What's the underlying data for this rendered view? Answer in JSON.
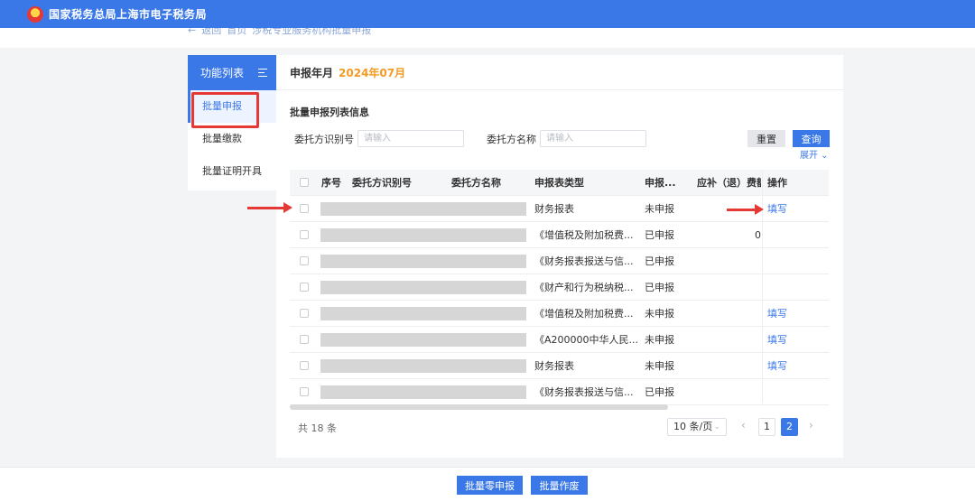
{
  "header": {
    "title": "国家税务总局上海市电子税务局"
  },
  "breadcrumb": {
    "back": "返回",
    "home": "首页",
    "current": "涉税专业服务机构批量申报"
  },
  "sidebar": {
    "title": "功能列表",
    "items": [
      {
        "label": "批量申报"
      },
      {
        "label": "批量缴款"
      },
      {
        "label": "批量证明开具"
      }
    ]
  },
  "main": {
    "period_label": "申报年月",
    "period_value": "2024年07月",
    "section_title": "批量申报列表信息",
    "filters": {
      "id_label": "委托方识别号",
      "id_placeholder": "请输入",
      "name_label": "委托方名称",
      "name_placeholder": "请输入"
    },
    "buttons": {
      "reset": "重置",
      "query": "查询",
      "expand": "展开 ⌄"
    },
    "table": {
      "columns": [
        "序号",
        "委托方识别号",
        "委托方名称",
        "申报表类型",
        "申报...",
        "应补（退）费额",
        "操作"
      ],
      "rows": [
        {
          "type": "财务报表",
          "status": "未申报",
          "amount": "",
          "action": "填写"
        },
        {
          "type": "《增值税及附加税费...",
          "status": "已申报",
          "amount": "0",
          "action": ""
        },
        {
          "type": "《财务报表报送与信...",
          "status": "已申报",
          "amount": "",
          "action": ""
        },
        {
          "type": "《财产和行为税纳税...",
          "status": "已申报",
          "amount": "",
          "action": ""
        },
        {
          "type": "《增值税及附加税费...",
          "status": "未申报",
          "amount": "",
          "action": "填写"
        },
        {
          "type": "《A200000中华人民...",
          "status": "未申报",
          "amount": "",
          "action": "填写"
        },
        {
          "type": "财务报表",
          "status": "未申报",
          "amount": "",
          "action": "填写"
        },
        {
          "type": "《财务报表报送与信...",
          "status": "已申报",
          "amount": "",
          "action": ""
        }
      ]
    },
    "pagination": {
      "total": "共 18 条",
      "page_size": "10 条/页",
      "pages": [
        "1",
        "2"
      ],
      "current_page": "2"
    }
  },
  "footer": {
    "batch_zero": "批量零申报",
    "batch_void": "批量作废"
  }
}
